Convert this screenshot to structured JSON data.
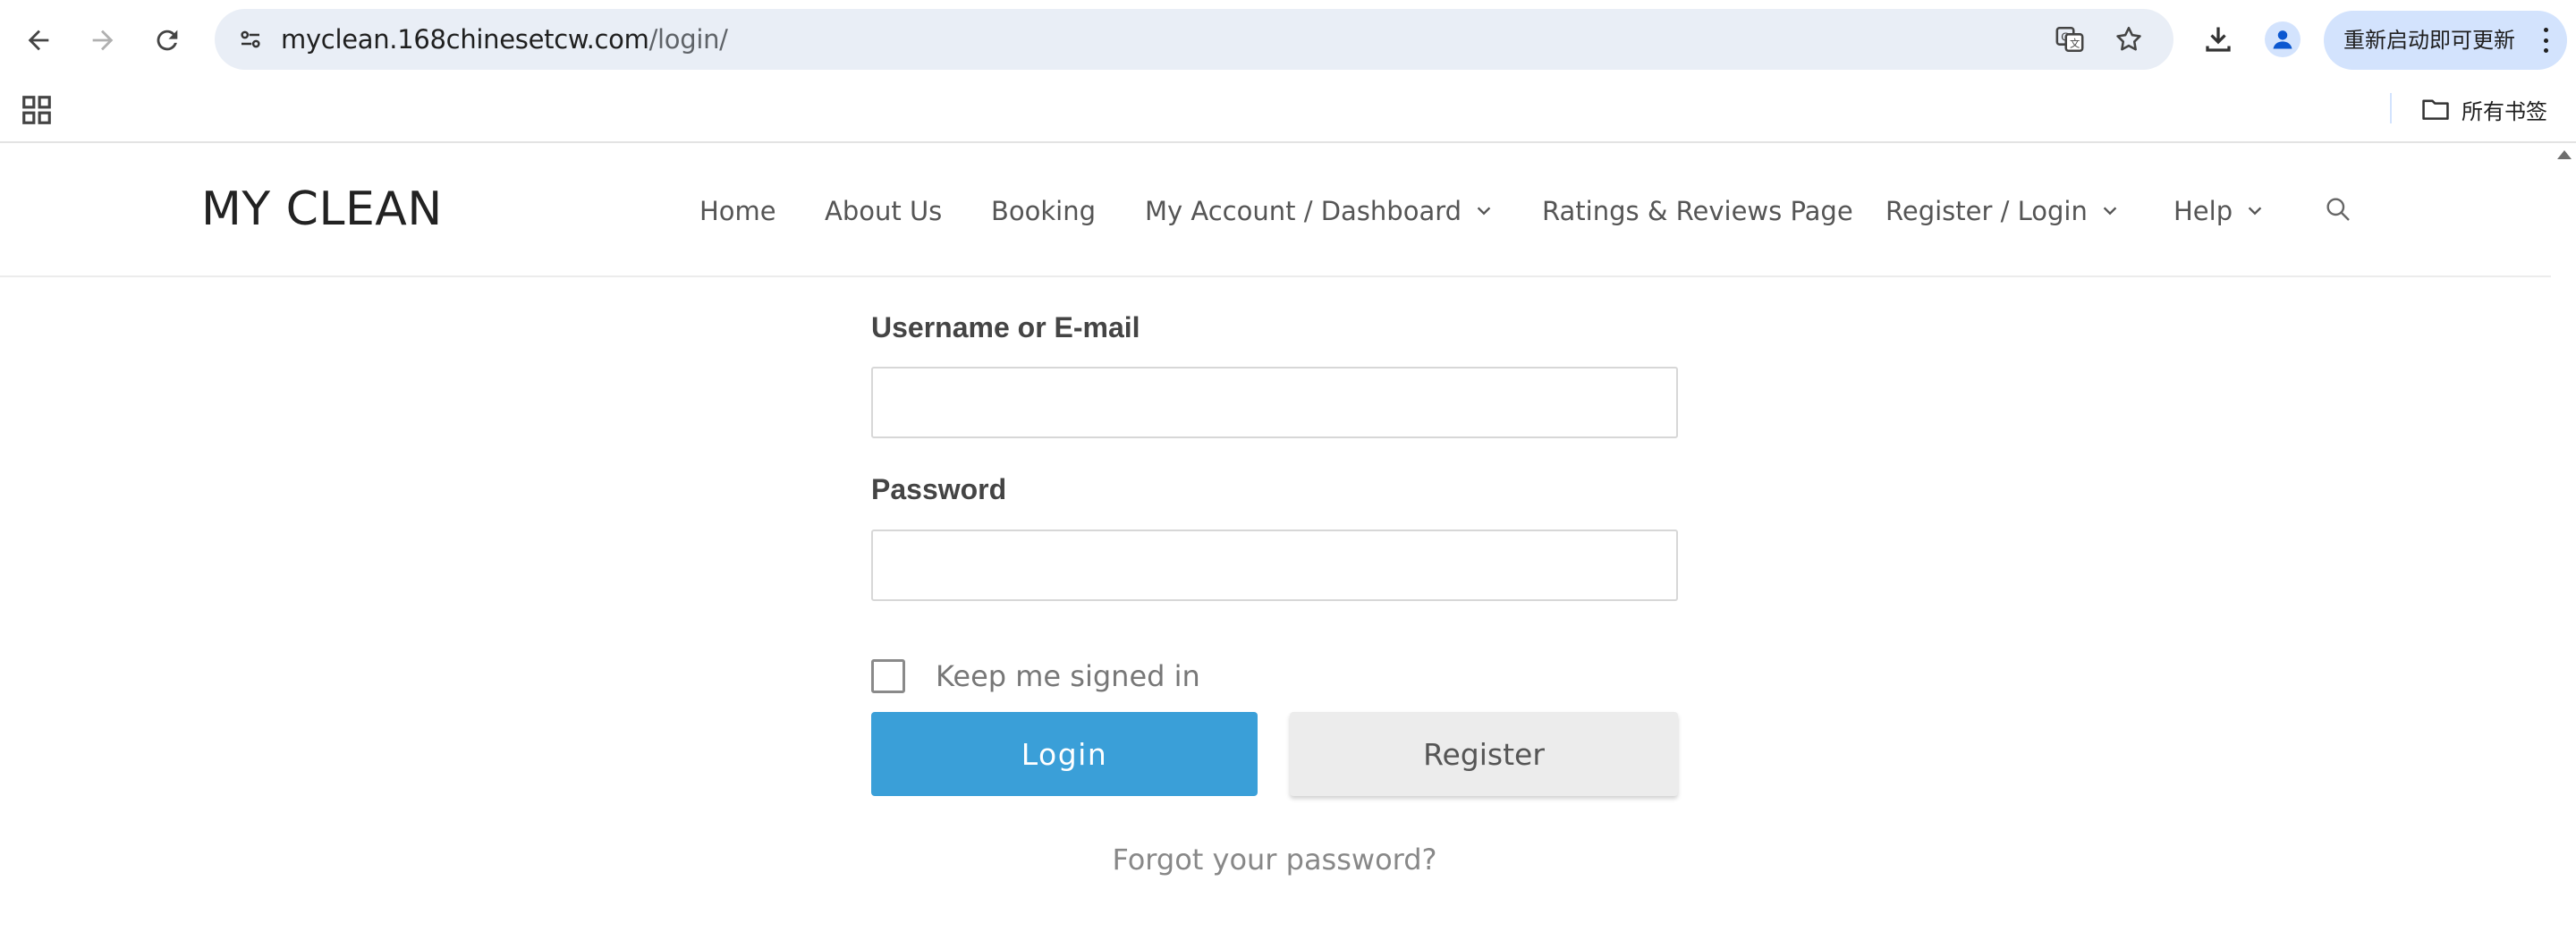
{
  "browser": {
    "url_host": "myclean.168chinesetcw.com",
    "url_path": "/login/",
    "update_button_label": "重新启动即可更新",
    "all_bookmarks_label": "所有书签",
    "icons": [
      "back-arrow-icon",
      "forward-arrow-icon",
      "reload-icon",
      "site-info-icon",
      "translate-icon",
      "star-icon",
      "download-icon",
      "profile-icon",
      "more-vert-icon",
      "apps-grid-icon",
      "folder-icon"
    ]
  },
  "site": {
    "title": "MY CLEAN",
    "nav": [
      {
        "label": "Home",
        "has_dropdown": false
      },
      {
        "label": "About Us",
        "has_dropdown": false
      },
      {
        "label": "Booking",
        "has_dropdown": false
      },
      {
        "label": "My Account / Dashboard",
        "has_dropdown": true
      },
      {
        "label": "Ratings & Reviews Page",
        "has_dropdown": false
      },
      {
        "label": "Register / Login",
        "has_dropdown": true
      },
      {
        "label": "Help",
        "has_dropdown": true
      }
    ]
  },
  "login": {
    "username_label": "Username or E-mail",
    "username_value": "",
    "password_label": "Password",
    "password_value": "",
    "remember_label": "Keep me signed in",
    "remember_checked": false,
    "login_button": "Login",
    "register_button": "Register",
    "forgot_link": "Forgot your password?"
  },
  "colors": {
    "login_button": "#3a9fd8",
    "register_button": "#ececec",
    "omnibox": "#e9eef6",
    "update_pill": "#d3e3fd"
  }
}
